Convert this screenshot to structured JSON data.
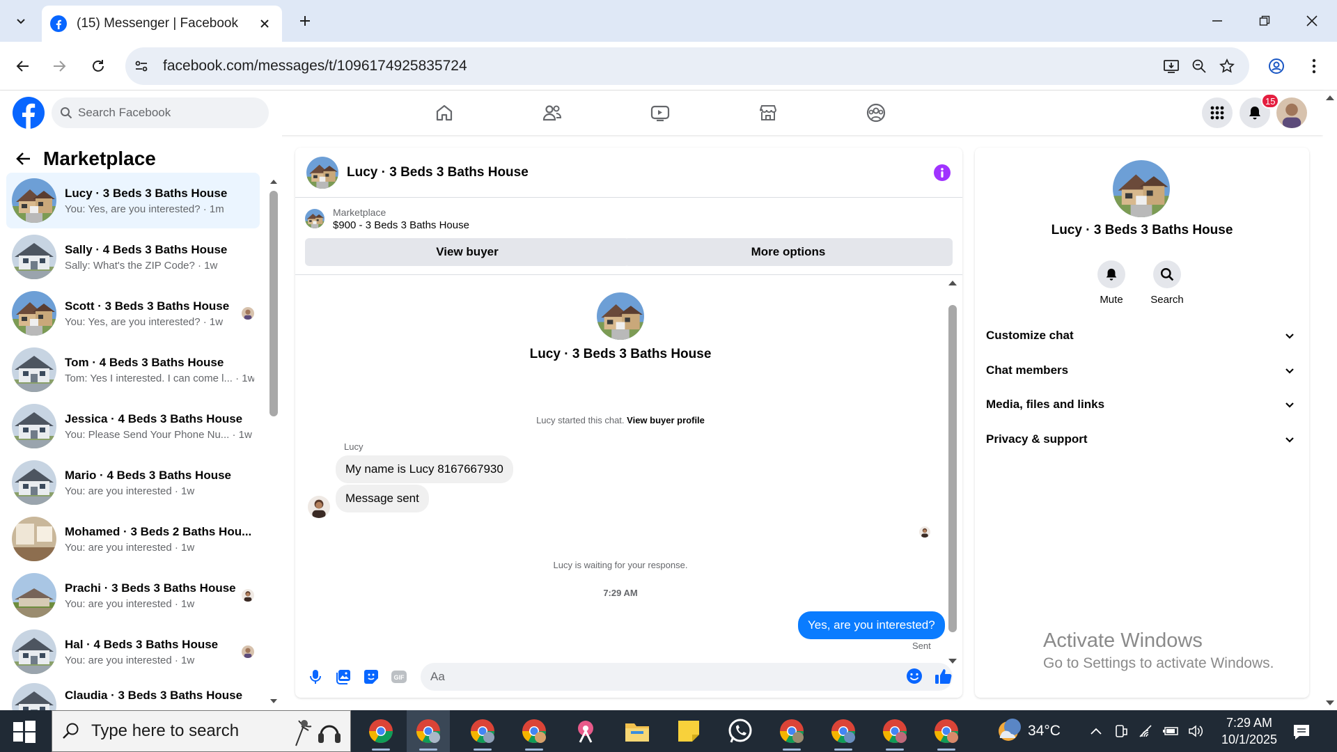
{
  "browser": {
    "tab_title": "(15) Messenger | Facebook",
    "url": "facebook.com/messages/t/1096174925835724"
  },
  "fb": {
    "search_placeholder": "Search Facebook",
    "notification_count": "15"
  },
  "sidebar": {
    "title": "Marketplace",
    "conversations": [
      {
        "name": "Lucy · 3 Beds 3 Baths House",
        "preview": "You: Yes, are you interested? · 1m",
        "active": true
      },
      {
        "name": "Sally · 4 Beds 3 Baths House",
        "preview": "Sally: What's the ZIP Code? · 1w"
      },
      {
        "name": "Scott · 3 Beds 3 Baths House",
        "preview": "You: Yes, are you interested? · 1w"
      },
      {
        "name": "Tom · 4 Beds 3 Baths House",
        "preview": "Tom: Yes I interested. I can come l... · 1w"
      },
      {
        "name": "Jessica · 4 Beds 3 Baths House",
        "preview": "You: Please Send Your Phone Nu... · 1w"
      },
      {
        "name": "Mario · 4 Beds 3 Baths House",
        "preview": "You: are you interested · 1w"
      },
      {
        "name": "Mohamed · 3 Beds 2 Baths Hou...",
        "preview": "You: are you interested · 1w"
      },
      {
        "name": "Prachi · 3 Beds 3 Baths House",
        "preview": "You: are you interested · 1w"
      },
      {
        "name": "Hal · 4 Beds 3 Baths House",
        "preview": "You: are you interested · 1w"
      },
      {
        "name": "Claudia · 3 Beds 3 Baths House",
        "preview": ""
      }
    ]
  },
  "chat": {
    "title": "Lucy · 3 Beds 3 Baths House",
    "marketplace_label": "Marketplace",
    "listing": "$900 - 3 Beds 3 Baths House",
    "view_buyer": "View buyer",
    "more_options": "More options",
    "intro_name": "Lucy · 3 Beds 3 Baths House",
    "started_text": "Lucy started this chat.",
    "view_buyer_profile": "View buyer profile",
    "sender": "Lucy",
    "messages": [
      "My name is Lucy 8167667930",
      "Message sent"
    ],
    "waiting": "Lucy is waiting for your response.",
    "time": "7:29 AM",
    "outgoing": "Yes, are you interested?",
    "sent_label": "Sent",
    "input_placeholder": "Aa"
  },
  "details": {
    "name": "Lucy · 3 Beds 3 Baths House",
    "mute": "Mute",
    "search": "Search",
    "sections": [
      "Customize chat",
      "Chat members",
      "Media, files and links",
      "Privacy & support"
    ]
  },
  "watermark": {
    "line1": "Activate Windows",
    "line2": "Go to Settings to activate Windows."
  },
  "taskbar": {
    "search_placeholder": "Type here to search",
    "temperature": "34°C",
    "time": "7:29 AM",
    "date": "10/1/2025"
  },
  "colors": {
    "fb_blue": "#0866ff",
    "bubble_blue": "#0a7cff",
    "info_purple": "#a033ff",
    "badge_red": "#e41e3f"
  }
}
